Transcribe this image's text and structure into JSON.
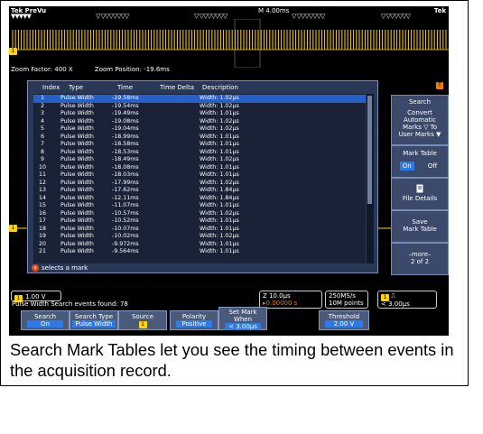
{
  "caption": "Search Mark Tables let you see the timing between events in the acquisition record.",
  "topbar": {
    "brand_left": "Tek PreVu",
    "timebase": "M 4.00ms",
    "brand_right": "Tek",
    "marks": [
      "▼▼▼▼▼",
      "▽ ▽▽▽▽▽▽▽",
      "▽ ▽▽▽▽▽▽▽",
      "▽ ▽▽▽▽▽▽▽",
      "▽ ▽▽▽▽▽▽"
    ]
  },
  "zoom": {
    "factor": "Zoom Factor: 400 X",
    "position": "Zoom Position: -19.6ms"
  },
  "channel_marker": "1",
  "trigger_marker": "T",
  "table": {
    "headers": [
      "Index",
      "Type",
      "Time",
      "Time Delta",
      "Description"
    ],
    "rows": [
      [
        "1",
        "Pulse Width",
        "-19.58ms",
        "",
        "Width: 1.02µs"
      ],
      [
        "2",
        "Pulse Width",
        "-19.54ms",
        "",
        "Width: 1.02µs"
      ],
      [
        "3",
        "Pulse Width",
        "-19.49ms",
        "",
        "Width: 1.01µs"
      ],
      [
        "4",
        "Pulse Width",
        "-19.08ms",
        "",
        "Width: 1.02µs"
      ],
      [
        "5",
        "Pulse Width",
        "-19.04ms",
        "",
        "Width: 1.02µs"
      ],
      [
        "6",
        "Pulse Width",
        "-18.99ms",
        "",
        "Width: 1.01µs"
      ],
      [
        "7",
        "Pulse Width",
        "-18.58ms",
        "",
        "Width: 1.01µs"
      ],
      [
        "8",
        "Pulse Width",
        "-18.53ms",
        "",
        "Width: 1.01µs"
      ],
      [
        "9",
        "Pulse Width",
        "-18.49ms",
        "",
        "Width: 1.02µs"
      ],
      [
        "10",
        "Pulse Width",
        "-18.08ms",
        "",
        "Width: 1.01µs"
      ],
      [
        "11",
        "Pulse Width",
        "-18.03ms",
        "",
        "Width: 1.01µs"
      ],
      [
        "12",
        "Pulse Width",
        "-17.99ms",
        "",
        "Width: 1.02µs"
      ],
      [
        "13",
        "Pulse Width",
        "-17.62ms",
        "",
        "Width: 1.84µs"
      ],
      [
        "14",
        "Pulse Width",
        "-12.11ms",
        "",
        "Width: 1.84µs"
      ],
      [
        "15",
        "Pulse Width",
        "-11.07ms",
        "",
        "Width: 1.01µs"
      ],
      [
        "16",
        "Pulse Width",
        "-10.57ms",
        "",
        "Width: 1.02µs"
      ],
      [
        "17",
        "Pulse Width",
        "-10.52ms",
        "",
        "Width: 1.01µs"
      ],
      [
        "18",
        "Pulse Width",
        "-10.07ms",
        "",
        "Width: 1.01µs"
      ],
      [
        "19",
        "Pulse Width",
        "-10.02ms",
        "",
        "Width: 1.02µs"
      ],
      [
        "20",
        "Pulse Width",
        "-9.972ms",
        "",
        "Width: 1.01µs"
      ],
      [
        "21",
        "Pulse Width",
        "-9.564ms",
        "",
        "Width: 1.01µs"
      ]
    ],
    "footer_button": "a",
    "footer_text": "selects a mark"
  },
  "side_menu": {
    "search": "Search",
    "convert": [
      "Convert",
      "Automatic",
      "Marks ▽ To",
      "User Marks ▼"
    ],
    "mark_table": "Mark Table",
    "on": "On",
    "off": "Off",
    "file_details": "File Details",
    "save": [
      "Save",
      "Mark Table"
    ],
    "more": [
      "–more–",
      "2 of 2"
    ]
  },
  "status": {
    "ch1_level": "1.00 V",
    "search_found": "Pulse Width Search events found: 78",
    "horiz": "Z 10.0µs",
    "horiz_delay": "▸0.00000 s",
    "rate": "250MS/s",
    "points": "10M points",
    "trig_ch": "1",
    "trig_level": "< 3.00µs"
  },
  "bottom_buttons": [
    {
      "title": "Search",
      "value": "On"
    },
    {
      "title": "Search Type",
      "value": "Pulse Width"
    },
    {
      "title": "Source",
      "value": "1"
    },
    {
      "title": "Polarity",
      "value": "Positive"
    },
    {
      "title": "Set Mark When",
      "value": "< 3.00µs"
    },
    {
      "title": "Threshold",
      "value": "2.00 V"
    }
  ],
  "colors": {
    "waveform": "#ffd400",
    "selection": "#2760c8",
    "accent": "#2e7be8",
    "trigger": "#f08000"
  }
}
